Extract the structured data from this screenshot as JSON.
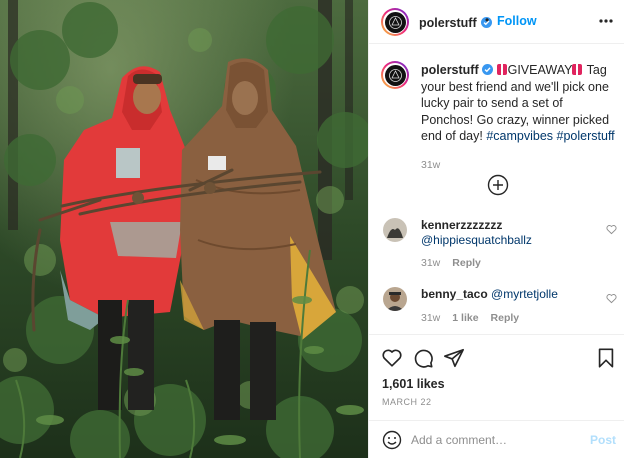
{
  "colors": {
    "accent": "#0095f6",
    "verified": "#3897f0",
    "link": "#00376b",
    "muted": "#8e8e8e",
    "poncho_red": "#e23a3a",
    "poncho_brown": "#8a6040"
  },
  "post": {
    "image_alt": "Two people in a forest wearing a red and a brown hooded poncho, holding branches",
    "header": {
      "username": "polerstuff",
      "verified_icon": "verified-badge-icon",
      "follow_label": "Follow",
      "more_icon": "more-options-icon"
    },
    "caption": {
      "username": "polerstuff",
      "text_before": "GIVEAWAY",
      "text_main": " Tag your best friend and we'll pick one lucky pair to send a set of Ponchos! Go crazy, winner picked end of day! ",
      "hashtag_1": "#campvibes",
      "hashtag_2": "#polerstuff",
      "age": "31w"
    },
    "add_icon": "add-circle-icon",
    "comments": [
      {
        "username": "kennerzzzzzzz",
        "text": "@hippiesquatchballz",
        "age": "31w",
        "likes": "",
        "reply_label": "Reply"
      },
      {
        "username": "benny_taco",
        "text": "@myrtetjolle",
        "age": "31w",
        "likes": "1 like",
        "reply_label": "Reply"
      }
    ],
    "actions": {
      "like_icon": "heart-icon",
      "comment_icon": "comment-icon",
      "share_icon": "share-icon",
      "save_icon": "bookmark-icon"
    },
    "likes": "1,601 likes",
    "date": "MARCH 22",
    "comment_box": {
      "emoji_icon": "emoji-icon",
      "placeholder": "Add a comment…",
      "post_label": "Post"
    }
  }
}
